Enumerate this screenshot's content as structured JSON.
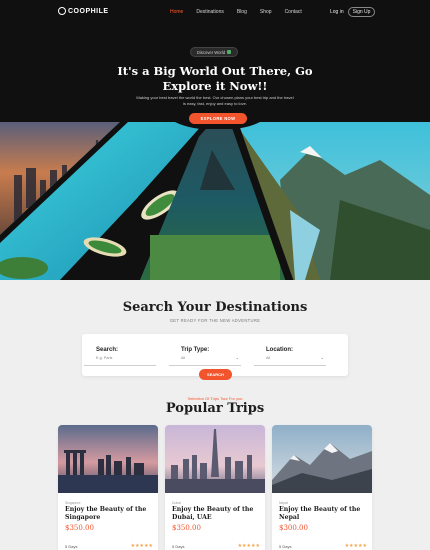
{
  "nav": {
    "logo": "COOPHILE",
    "links": [
      "Home",
      "Destinations",
      "Blog",
      "Shop",
      "Contact"
    ],
    "login": "Log in",
    "signup": "Sign Up"
  },
  "hero": {
    "badge": "Discover World",
    "title": "It's a Big World Out There, Go Explore it Now!!",
    "subtitle": "Making your best travel the world the best. Our chosen plans your best trip and the travel is easy, fast, enjoy and easy to love.",
    "cta": "EXPLORE NOW"
  },
  "search": {
    "title": "Search Your Destinations",
    "subtitle": "GET READY FOR THE NEW ADVENTURE",
    "fields": [
      {
        "label": "Search:",
        "value": "E.g. Paris"
      },
      {
        "label": "Trip Type:",
        "value": "All"
      },
      {
        "label": "Location:",
        "value": "All"
      }
    ],
    "button": "SEARCH"
  },
  "popular": {
    "kicker": "Selection Of Trips Tour For you",
    "title": "Popular Trips",
    "cards": [
      {
        "location": "Singapore",
        "title": "Enjoy the Beauty of the Singapore",
        "price": "$350.00",
        "meta": "5 Days",
        "stars": "★★★★★"
      },
      {
        "location": "Dubai",
        "title": "Enjoy the Beauty of the Dubai, UAE",
        "price": "$350.00",
        "meta": "5 Days",
        "stars": "★★★★★"
      },
      {
        "location": "Nepal",
        "title": "Enjoy the Beauty of the Nepal",
        "price": "$300.00",
        "meta": "5 Days",
        "stars": "★★★★★"
      }
    ]
  },
  "colors": {
    "accent": "#f2542d",
    "hero_bg": "#101010",
    "page_bg": "#efefef"
  }
}
